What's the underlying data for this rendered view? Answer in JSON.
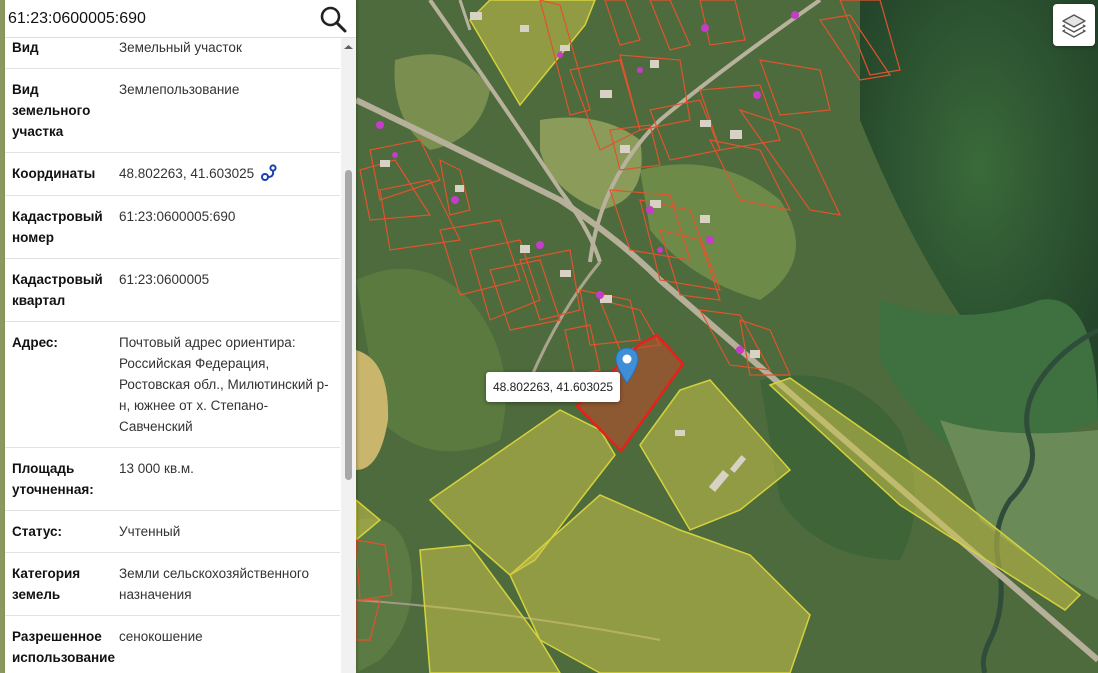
{
  "search": {
    "value": "61:23:0600005:690"
  },
  "info_rows": [
    {
      "label": "Вид",
      "value": "Земельный участок"
    },
    {
      "label": "Вид земельного участка",
      "value": "Землепользование"
    },
    {
      "label": "Координаты",
      "value": "48.802263, 41.603025"
    },
    {
      "label": "Кадастровый номер",
      "value": "61:23:0600005:690"
    },
    {
      "label": "Кадастровый квартал",
      "value": "61:23:0600005"
    },
    {
      "label": "Адрес:",
      "value": "Почтовый адрес ориентира: Российская Федерация, Ростовская обл., Милютинский р-н, южнее от х. Степано-Савченский"
    },
    {
      "label": "Площадь уточненная:",
      "value": "13 000 кв.м."
    },
    {
      "label": "Статус:",
      "value": "Учтенный"
    },
    {
      "label": "Категория земель",
      "value": "Земли сельскохозяйственного назначения"
    },
    {
      "label": "Разрешенное использование",
      "value": "сенокошение"
    }
  ],
  "map": {
    "popup_text": "48.802263, 41.603025",
    "icons": {
      "search": "search-icon",
      "layers": "layers-icon",
      "copy": "copy-coordinates-icon",
      "marker": "map-marker-icon"
    },
    "colors": {
      "selected_parcel": "#e8201a",
      "parcel_outline": "#e0542e",
      "land_parcel_outline": "#d6d23c",
      "land_parcel_fill": "#c9c24a",
      "marker": "#3f8fd6",
      "coordinate_icon": "#1a3fb0"
    }
  }
}
